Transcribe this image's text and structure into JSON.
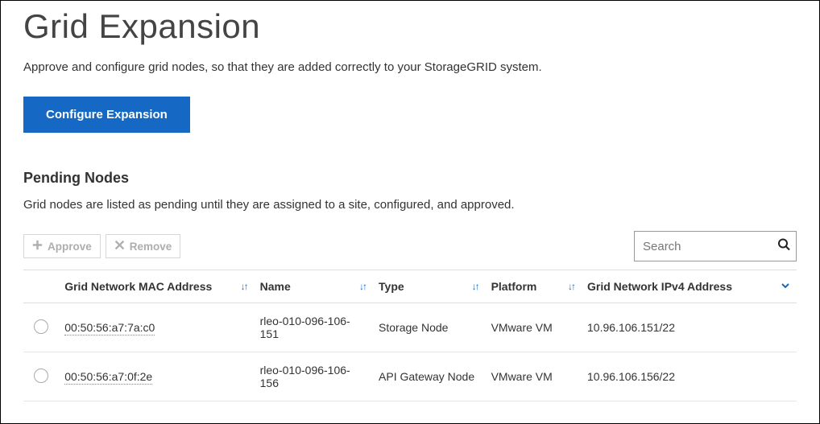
{
  "page": {
    "title": "Grid Expansion",
    "subtitle": "Approve and configure grid nodes, so that they are added correctly to your StorageGRID system.",
    "primary_button": "Configure Expansion"
  },
  "pending": {
    "heading": "Pending Nodes",
    "description": "Grid nodes are listed as pending until they are assigned to a site, configured, and approved.",
    "approve_label": "Approve",
    "remove_label": "Remove",
    "search_placeholder": "Search",
    "columns": {
      "mac": "Grid Network MAC Address",
      "name": "Name",
      "type": "Type",
      "platform": "Platform",
      "ipv4": "Grid Network IPv4 Address"
    },
    "rows": [
      {
        "mac": "00:50:56:a7:7a:c0",
        "name": "rleo-010-096-106-151",
        "type": "Storage Node",
        "platform": "VMware VM",
        "ipv4": "10.96.106.151/22"
      },
      {
        "mac": "00:50:56:a7:0f:2e",
        "name": "rleo-010-096-106-156",
        "type": "API Gateway Node",
        "platform": "VMware VM",
        "ipv4": "10.96.106.156/22"
      }
    ]
  }
}
